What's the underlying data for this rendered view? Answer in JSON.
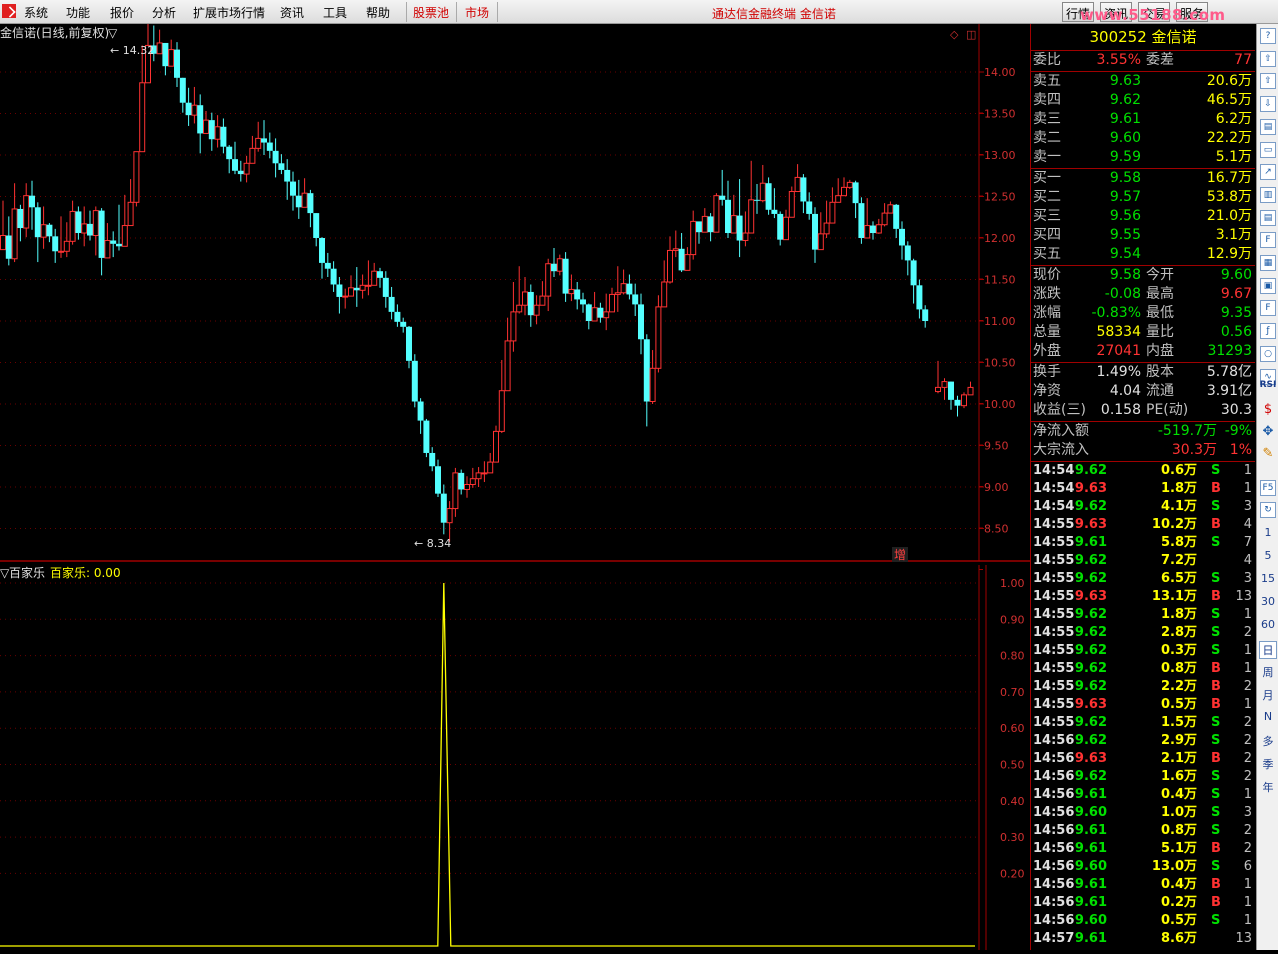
{
  "menu": {
    "items": [
      "系统",
      "功能",
      "报价",
      "分析",
      "扩展市场行情",
      "资讯",
      "工具",
      "帮助"
    ],
    "red_items": [
      "股票池",
      "市场"
    ],
    "title": "通达信金融终端  金信诺",
    "right_buttons": [
      "行情",
      "资讯",
      "交易",
      "服务"
    ],
    "watermark": "www.55188.com"
  },
  "chart": {
    "title": "金信诺(日线,前复权)",
    "high_label": "14.32",
    "low_label": "8.34",
    "price_ticks": [
      "14.00",
      "13.50",
      "13.00",
      "12.50",
      "12.00",
      "11.50",
      "11.00",
      "10.50",
      "10.00",
      "9.50",
      "9.00",
      "8.50"
    ],
    "tag": "增",
    "candles": [
      [
        11.86,
        12.03,
        12.45,
        11.91
      ],
      [
        12.03,
        11.75,
        12.26,
        11.67
      ],
      [
        11.75,
        12.35,
        12.66,
        11.71
      ],
      [
        12.35,
        12.12,
        12.4,
        11.96
      ],
      [
        12.12,
        12.51,
        12.66,
        12.01
      ],
      [
        12.51,
        12.37,
        12.69,
        12.1
      ],
      [
        12.37,
        12.01,
        12.43,
        11.71
      ],
      [
        12.01,
        12.16,
        12.38,
        11.87
      ],
      [
        12.16,
        12.02,
        12.18,
        11.95
      ],
      [
        12.02,
        11.84,
        12.11,
        11.7
      ],
      [
        11.84,
        11.84,
        12.26,
        11.76
      ],
      [
        11.84,
        11.96,
        12.19,
        11.77
      ],
      [
        11.96,
        12.32,
        12.45,
        11.92
      ],
      [
        12.32,
        12.06,
        12.38,
        11.98
      ],
      [
        12.06,
        12.17,
        12.38,
        11.9
      ],
      [
        12.17,
        12.03,
        12.33,
        11.97
      ],
      [
        12.03,
        12.33,
        12.38,
        11.79
      ],
      [
        12.33,
        11.76,
        12.36,
        11.55
      ],
      [
        11.76,
        11.97,
        12.18,
        11.78
      ],
      [
        11.97,
        11.93,
        12.08,
        11.77
      ],
      [
        11.93,
        11.9,
        12.4,
        11.85
      ],
      [
        11.9,
        12.15,
        12.52,
        12.06
      ],
      [
        12.15,
        12.43,
        12.71,
        12.43
      ],
      [
        12.43,
        13.04,
        13.04,
        12.38
      ],
      [
        13.04,
        13.87,
        14.32,
        13.83
      ],
      [
        13.87,
        14.32,
        14.61,
        14.01
      ],
      [
        14.32,
        14.22,
        14.56,
        14.13
      ],
      [
        14.22,
        14.35,
        14.51,
        14.28
      ],
      [
        14.35,
        14.07,
        14.28,
        13.96
      ],
      [
        14.07,
        14.27,
        14.39,
        14.11
      ],
      [
        14.27,
        13.93,
        14.36,
        13.82
      ],
      [
        13.93,
        13.63,
        13.93,
        13.51
      ],
      [
        13.63,
        13.48,
        13.81,
        13.35
      ],
      [
        13.48,
        13.6,
        13.82,
        13.38
      ],
      [
        13.6,
        13.26,
        13.73,
        13.02
      ],
      [
        13.26,
        13.42,
        13.53,
        13.3
      ],
      [
        13.42,
        13.19,
        13.51,
        13.05
      ],
      [
        13.19,
        13.34,
        13.48,
        13.09
      ],
      [
        13.34,
        13.1,
        13.44,
        13.02
      ],
      [
        13.1,
        12.95,
        13.12,
        12.78
      ],
      [
        12.95,
        12.81,
        13.16,
        12.77
      ],
      [
        12.81,
        12.77,
        12.93,
        12.68
      ],
      [
        12.77,
        12.9,
        12.99,
        12.67
      ],
      [
        12.9,
        13.08,
        13.23,
        12.9
      ],
      [
        13.08,
        13.2,
        13.4,
        13.04
      ],
      [
        13.2,
        13.15,
        13.42,
        13.0
      ],
      [
        13.15,
        13.05,
        13.27,
        12.96
      ],
      [
        13.05,
        12.9,
        13.2,
        12.73
      ],
      [
        12.9,
        12.82,
        13.01,
        12.77
      ],
      [
        12.82,
        12.68,
        12.95,
        12.46
      ],
      [
        12.68,
        12.51,
        12.8,
        12.33
      ],
      [
        12.51,
        12.37,
        12.7,
        12.23
      ],
      [
        12.37,
        12.54,
        12.72,
        12.4
      ],
      [
        12.54,
        12.3,
        12.58,
        12.13
      ],
      [
        12.3,
        12.0,
        12.3,
        11.9
      ],
      [
        12.0,
        11.7,
        12.01,
        11.51
      ],
      [
        11.7,
        11.63,
        11.82,
        11.53
      ],
      [
        11.63,
        11.44,
        11.72,
        11.35
      ],
      [
        11.44,
        11.29,
        11.53,
        11.09
      ],
      [
        11.29,
        11.3,
        11.39,
        11.15
      ],
      [
        11.3,
        11.4,
        11.55,
        11.3
      ],
      [
        11.4,
        11.37,
        11.65,
        11.17
      ],
      [
        11.37,
        11.43,
        11.56,
        11.27
      ],
      [
        11.43,
        11.43,
        11.73,
        11.31
      ],
      [
        11.43,
        11.6,
        11.7,
        11.46
      ],
      [
        11.6,
        11.52,
        11.64,
        11.4
      ],
      [
        11.52,
        11.29,
        11.6,
        11.16
      ],
      [
        11.29,
        11.11,
        11.41,
        11.02
      ],
      [
        11.11,
        10.99,
        11.2,
        10.93
      ],
      [
        10.99,
        10.93,
        11.04,
        10.86
      ],
      [
        10.93,
        10.52,
        10.94,
        10.43
      ],
      [
        10.52,
        10.03,
        10.6,
        9.96
      ],
      [
        10.03,
        9.8,
        10.07,
        9.64
      ],
      [
        9.8,
        9.41,
        9.82,
        9.36
      ],
      [
        9.41,
        9.25,
        9.48,
        9.19
      ],
      [
        9.25,
        8.92,
        9.33,
        8.88
      ],
      [
        8.92,
        8.57,
        9.03,
        8.43
      ],
      [
        8.57,
        8.74,
        8.83,
        8.34
      ],
      [
        8.74,
        9.17,
        9.23,
        8.64
      ],
      [
        9.17,
        8.97,
        9.21,
        8.91
      ],
      [
        8.97,
        9.03,
        9.13,
        8.87
      ],
      [
        9.03,
        9.1,
        9.23,
        8.99
      ],
      [
        9.1,
        9.17,
        9.24,
        9.0
      ],
      [
        9.17,
        9.17,
        9.31,
        9.06
      ],
      [
        9.17,
        9.3,
        9.41,
        9.22
      ],
      [
        9.3,
        9.67,
        9.74,
        9.38
      ],
      [
        9.67,
        10.16,
        10.53,
        9.65
      ],
      [
        10.16,
        10.76,
        11.04,
        10.18
      ],
      [
        10.76,
        11.11,
        11.47,
        10.63
      ],
      [
        11.11,
        11.19,
        11.66,
        11.09
      ],
      [
        11.19,
        11.35,
        11.53,
        11.07
      ],
      [
        11.35,
        11.07,
        11.44,
        10.93
      ],
      [
        11.07,
        11.19,
        11.31,
        10.96
      ],
      [
        11.19,
        11.3,
        11.48,
        11.2
      ],
      [
        11.3,
        11.69,
        11.75,
        11.12
      ],
      [
        11.69,
        11.6,
        11.88,
        11.53
      ],
      [
        11.6,
        11.75,
        11.8,
        11.55
      ],
      [
        11.75,
        11.33,
        11.83,
        11.23
      ],
      [
        11.33,
        11.38,
        11.56,
        11.24
      ],
      [
        11.38,
        11.26,
        11.47,
        11.14
      ],
      [
        11.26,
        11.2,
        11.34,
        11.1
      ],
      [
        11.2,
        11.0,
        11.21,
        10.9
      ],
      [
        11.0,
        11.16,
        11.35,
        11.02
      ],
      [
        11.16,
        11.04,
        11.22,
        10.98
      ],
      [
        11.04,
        11.11,
        11.33,
        10.89
      ],
      [
        11.11,
        11.32,
        11.4,
        11.2
      ],
      [
        11.32,
        11.34,
        11.66,
        11.11
      ],
      [
        11.34,
        11.45,
        11.62,
        11.32
      ],
      [
        11.45,
        11.32,
        11.56,
        11.26
      ],
      [
        11.32,
        11.2,
        11.45,
        11.06
      ],
      [
        11.2,
        10.78,
        11.33,
        10.6
      ],
      [
        10.78,
        10.03,
        10.84,
        9.73
      ],
      [
        10.03,
        10.43,
        10.65,
        10.0
      ],
      [
        10.43,
        11.17,
        11.31,
        10.38
      ],
      [
        11.17,
        11.47,
        11.73,
        11.23
      ],
      [
        11.47,
        11.85,
        12.02,
        11.45
      ],
      [
        11.85,
        11.87,
        12.09,
        11.77
      ],
      [
        11.87,
        11.61,
        12.06,
        11.59
      ],
      [
        11.61,
        11.8,
        11.89,
        11.62
      ],
      [
        11.8,
        12.2,
        12.33,
        11.74
      ],
      [
        12.2,
        12.07,
        12.19,
        11.93
      ],
      [
        12.07,
        12.26,
        12.36,
        12.09
      ],
      [
        12.26,
        12.07,
        12.3,
        11.96
      ],
      [
        12.07,
        12.51,
        12.54,
        12.21
      ],
      [
        12.51,
        12.46,
        12.82,
        12.39
      ],
      [
        12.46,
        12.06,
        12.69,
        12.0
      ],
      [
        12.06,
        12.27,
        12.52,
        12.21
      ],
      [
        12.27,
        11.97,
        12.71,
        11.77
      ],
      [
        11.97,
        12.06,
        12.32,
        11.9
      ],
      [
        12.06,
        12.46,
        12.93,
        12.37
      ],
      [
        12.46,
        12.45,
        12.65,
        12.29
      ],
      [
        12.45,
        12.66,
        12.88,
        12.43
      ],
      [
        12.66,
        12.34,
        12.73,
        12.28
      ],
      [
        12.34,
        12.29,
        12.6,
        12.24
      ],
      [
        12.29,
        11.98,
        12.32,
        11.91
      ],
      [
        11.98,
        12.25,
        12.34,
        12.05
      ],
      [
        12.25,
        12.56,
        12.62,
        12.42
      ],
      [
        12.56,
        12.73,
        12.89,
        12.63
      ],
      [
        12.73,
        12.44,
        12.77,
        12.3
      ],
      [
        12.44,
        12.29,
        12.55,
        12.22
      ],
      [
        12.29,
        11.86,
        12.37,
        11.7
      ],
      [
        11.86,
        12.05,
        12.31,
        12.01
      ],
      [
        12.05,
        12.18,
        12.45,
        12.0
      ],
      [
        12.18,
        12.43,
        12.61,
        12.38
      ],
      [
        12.43,
        12.51,
        12.72,
        12.43
      ],
      [
        12.51,
        12.61,
        12.73,
        12.52
      ],
      [
        12.61,
        12.67,
        12.7,
        12.59
      ],
      [
        12.67,
        12.42,
        12.69,
        12.24
      ],
      [
        12.42,
        12.0,
        12.49,
        11.93
      ],
      [
        12.0,
        12.15,
        12.48,
        12.05
      ],
      [
        12.15,
        12.06,
        12.2,
        11.98
      ],
      [
        12.06,
        12.16,
        12.23,
        12.05
      ],
      [
        12.16,
        12.3,
        12.42,
        12.14
      ],
      [
        12.3,
        12.4,
        12.44,
        12.32
      ],
      [
        12.4,
        12.11,
        12.41,
        12.0
      ],
      [
        12.11,
        11.91,
        12.2,
        11.74
      ],
      [
        11.91,
        11.73,
        11.96,
        11.55
      ],
      [
        11.73,
        11.43,
        11.75,
        11.21
      ],
      [
        11.43,
        11.14,
        11.5,
        11.03
      ],
      [
        11.14,
        11.0,
        11.19,
        10.92
      ]
    ],
    "tail_candles": [
      [
        10.15,
        10.2,
        10.52,
        10.13
      ],
      [
        10.2,
        10.27,
        10.31,
        10.05
      ],
      [
        10.27,
        10.05,
        10.27,
        9.93
      ],
      [
        10.05,
        9.98,
        10.1,
        9.85
      ],
      [
        9.98,
        10.11,
        10.14,
        9.95
      ],
      [
        10.11,
        10.2,
        10.27,
        10.11
      ]
    ],
    "indicator": {
      "name": "百家乐",
      "label": "百家乐: 0.00",
      "ticks": [
        "1.00",
        "0.90",
        "0.80",
        "0.70",
        "0.60",
        "0.50",
        "0.40",
        "0.30",
        "0.20"
      ],
      "spike_value": 1.0,
      "spike_index": 76
    }
  },
  "panel": {
    "header": "300252 金信诺",
    "weibi": {
      "label": "委比",
      "value": "3.55%",
      "label2": "委差",
      "value2": "77"
    },
    "sell": [
      {
        "label": "卖五",
        "price": "9.63",
        "vol": "20.6万"
      },
      {
        "label": "卖四",
        "price": "9.62",
        "vol": "46.5万"
      },
      {
        "label": "卖三",
        "price": "9.61",
        "vol": "6.2万"
      },
      {
        "label": "卖二",
        "price": "9.60",
        "vol": "22.2万"
      },
      {
        "label": "卖一",
        "price": "9.59",
        "vol": "5.1万"
      }
    ],
    "buy": [
      {
        "label": "买一",
        "price": "9.58",
        "vol": "16.7万"
      },
      {
        "label": "买二",
        "price": "9.57",
        "vol": "53.8万"
      },
      {
        "label": "买三",
        "price": "9.56",
        "vol": "21.0万"
      },
      {
        "label": "买四",
        "price": "9.55",
        "vol": "3.1万"
      },
      {
        "label": "买五",
        "price": "9.54",
        "vol": "12.9万"
      }
    ],
    "quote": [
      {
        "l1": "现价",
        "v1": "9.58",
        "c1": "g",
        "l2": "今开",
        "v2": "9.60",
        "c2": "g"
      },
      {
        "l1": "涨跌",
        "v1": "-0.08",
        "c1": "g",
        "l2": "最高",
        "v2": "9.67",
        "c2": "r"
      },
      {
        "l1": "涨幅",
        "v1": "-0.83%",
        "c1": "g",
        "l2": "最低",
        "v2": "9.35",
        "c2": "g"
      },
      {
        "l1": "总量",
        "v1": "58334",
        "c1": "y",
        "l2": "量比",
        "v2": "0.56",
        "c2": "g"
      },
      {
        "l1": "外盘",
        "v1": "27041",
        "c1": "r",
        "l2": "内盘",
        "v2": "31293",
        "c2": "g"
      }
    ],
    "fund": [
      {
        "l1": "换手",
        "v1": "1.49%",
        "l2": "股本",
        "v2": "5.78亿"
      },
      {
        "l1": "净资",
        "v1": "4.04",
        "l2": "流通",
        "v2": "3.91亿"
      },
      {
        "l1": "收益(三)",
        "v1": "0.158",
        "l2": "PE(动)",
        "v2": "30.3"
      }
    ],
    "flow": [
      {
        "label": "净流入额",
        "value": "-519.7万",
        "c": "g",
        "pct": "-9%"
      },
      {
        "label": "大宗流入",
        "value": "30.3万",
        "c": "r",
        "pct": "1%"
      }
    ],
    "ticks": [
      [
        "14:54",
        "9.62",
        "0.6万",
        "S",
        "1"
      ],
      [
        "14:54",
        "9.63",
        "1.8万",
        "B",
        "1"
      ],
      [
        "14:54",
        "9.62",
        "4.1万",
        "S",
        "3"
      ],
      [
        "14:55",
        "9.63",
        "10.2万",
        "B",
        "4"
      ],
      [
        "14:55",
        "9.61",
        "5.8万",
        "S",
        "7"
      ],
      [
        "14:55",
        "9.62",
        "7.2万",
        "",
        "4"
      ],
      [
        "14:55",
        "9.62",
        "6.5万",
        "S",
        "3"
      ],
      [
        "14:55",
        "9.63",
        "13.1万",
        "B",
        "13"
      ],
      [
        "14:55",
        "9.62",
        "1.8万",
        "S",
        "1"
      ],
      [
        "14:55",
        "9.62",
        "2.8万",
        "S",
        "2"
      ],
      [
        "14:55",
        "9.62",
        "0.3万",
        "S",
        "1"
      ],
      [
        "14:55",
        "9.62",
        "0.8万",
        "B",
        "1"
      ],
      [
        "14:55",
        "9.62",
        "2.2万",
        "B",
        "2"
      ],
      [
        "14:55",
        "9.63",
        "0.5万",
        "B",
        "1"
      ],
      [
        "14:55",
        "9.62",
        "1.5万",
        "S",
        "2"
      ],
      [
        "14:56",
        "9.62",
        "2.9万",
        "S",
        "2"
      ],
      [
        "14:56",
        "9.63",
        "2.1万",
        "B",
        "2"
      ],
      [
        "14:56",
        "9.62",
        "1.6万",
        "S",
        "2"
      ],
      [
        "14:56",
        "9.61",
        "0.4万",
        "S",
        "1"
      ],
      [
        "14:56",
        "9.60",
        "1.0万",
        "S",
        "3"
      ],
      [
        "14:56",
        "9.61",
        "0.8万",
        "S",
        "2"
      ],
      [
        "14:56",
        "9.61",
        "5.1万",
        "B",
        "2"
      ],
      [
        "14:56",
        "9.60",
        "13.0万",
        "S",
        "6"
      ],
      [
        "14:56",
        "9.61",
        "0.4万",
        "B",
        "1"
      ],
      [
        "14:56",
        "9.61",
        "0.2万",
        "B",
        "1"
      ],
      [
        "14:56",
        "9.60",
        "0.5万",
        "S",
        "1"
      ],
      [
        "14:57",
        "9.61",
        "8.6万",
        "",
        "13"
      ]
    ]
  },
  "sidebar": {
    "periods": [
      "1",
      "5",
      "15",
      "30",
      "60",
      "日",
      "周",
      "月",
      "N",
      "多",
      "季",
      "年"
    ],
    "icons": [
      "RSI",
      "F5"
    ]
  }
}
